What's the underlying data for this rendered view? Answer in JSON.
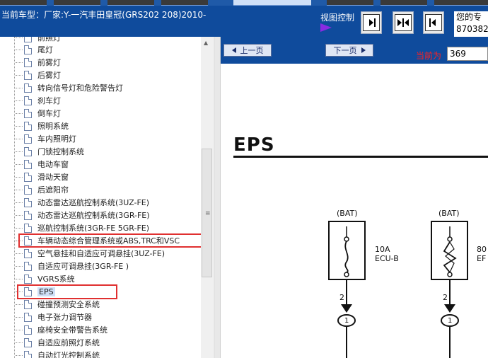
{
  "header": {
    "car_model": "当前车型：厂家:Y-一汽丰田皇冠(GRS202 208)2010-",
    "view_control_label": "视图控制",
    "contact_line1": "您的专",
    "contact_line2": "870382"
  },
  "tree": {
    "items": [
      {
        "label": "前照灯"
      },
      {
        "label": "尾灯"
      },
      {
        "label": "前雾灯"
      },
      {
        "label": "后雾灯"
      },
      {
        "label": "转向信号灯和危险警告灯"
      },
      {
        "label": "刹车灯"
      },
      {
        "label": "倒车灯"
      },
      {
        "label": "照明系统"
      },
      {
        "label": "车内照明灯"
      },
      {
        "label": "门锁控制系统"
      },
      {
        "label": "电动车窗"
      },
      {
        "label": "滑动天窗"
      },
      {
        "label": "后遮阳帘"
      },
      {
        "label": "动态雷达巡航控制系统(3UZ-FE)"
      },
      {
        "label": "动态雷达巡航控制系统(3GR-FE)"
      },
      {
        "label": "巡航控制系统(3GR-FE 5GR-FE)"
      },
      {
        "label": "车辆动态综合管理系统或ABS,TRC和VSC"
      },
      {
        "label": "空气悬挂和自适应可调悬挂(3UZ-FE)"
      },
      {
        "label": "自适应可调悬挂(3GR-FE )"
      },
      {
        "label": "VGRS系统"
      },
      {
        "label": "EPS"
      },
      {
        "label": "碰撞预测安全系统"
      },
      {
        "label": "电子张力调节器"
      },
      {
        "label": "座椅安全带警告系统"
      },
      {
        "label": "自适应前照灯系统"
      },
      {
        "label": "自动灯光控制系统"
      }
    ]
  },
  "nav": {
    "prev_label": "上一页",
    "next_label": "下一页",
    "current_label": "当前为",
    "current_page": "369"
  },
  "document": {
    "title": "EPS",
    "bat_label": "(BAT)",
    "fuse1_amp": "10A",
    "fuse1_name": "ECU-B",
    "fuse2_amp": "80",
    "fuse2_name": "EF",
    "pin": "2",
    "connector": "1"
  },
  "colors": {
    "header_blue": "#0f4b9c",
    "highlight_red": "#e03030",
    "current_label_red": "#ff2020",
    "arrow_purple": "#8a2be2"
  }
}
